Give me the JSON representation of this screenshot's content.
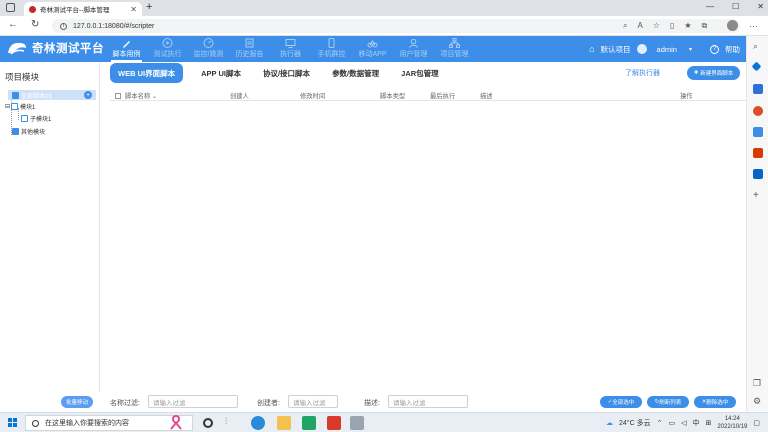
{
  "browser": {
    "tab_title": "奇林测试平台--脚本管理",
    "url": "127.0.0.1:18080/#/scripter"
  },
  "app": {
    "brand": "奇林测试平台",
    "nav": [
      {
        "label": "脚本用例",
        "icon": "pencil-icon",
        "active": true
      },
      {
        "label": "测试执行",
        "icon": "play-icon",
        "active": false
      },
      {
        "label": "监控/跳测",
        "icon": "monitor-gauge-icon",
        "active": false
      },
      {
        "label": "历史报告",
        "icon": "report-icon",
        "active": false
      },
      {
        "label": "执行器",
        "icon": "desktop-icon",
        "active": false
      },
      {
        "label": "手机群控",
        "icon": "phone-icon",
        "active": false
      },
      {
        "label": "移动APP",
        "icon": "bicycle-icon",
        "active": false
      },
      {
        "label": "用户管理",
        "icon": "user-icon",
        "active": false
      },
      {
        "label": "项目管理",
        "icon": "sitemap-icon",
        "active": false
      }
    ],
    "project": "默认项目",
    "user": "admin",
    "help": "帮助"
  },
  "tree": {
    "title": "项目模块",
    "root": "全部脚本[0]",
    "module1": "模块1",
    "submodule1": "子模块1",
    "other": "其他模块"
  },
  "subtabs": [
    "WEB UI界面脚本",
    "APP UI脚本",
    "协议/接口脚本",
    "参数/数据管理",
    "JAR包管理"
  ],
  "actions": {
    "know_exec": "了解执行器",
    "new_script": "新建界面脚本"
  },
  "table": {
    "columns": [
      "脚本名称",
      "创建人",
      "修改时间",
      "脚本类型",
      "最后执行",
      "描述",
      "操作"
    ]
  },
  "footer": {
    "batch_move": "批量移动",
    "name_label": "名称过滤:",
    "name_placeholder": "请输入过滤",
    "creator_label": "创建者:",
    "creator_placeholder": "请输入过滤",
    "desc_label": "描述:",
    "desc_placeholder": "请输入过滤",
    "select_all": "全部选中",
    "refresh": "刷新列表",
    "delete_selected": "删除选中"
  },
  "taskbar": {
    "search_placeholder": "在这里输入你要搜索的内容",
    "weather": "24°C 多云",
    "ime": "中",
    "time": "14:24",
    "date": "2022/10/19"
  },
  "colors": {
    "primary": "#3d8ee8"
  }
}
